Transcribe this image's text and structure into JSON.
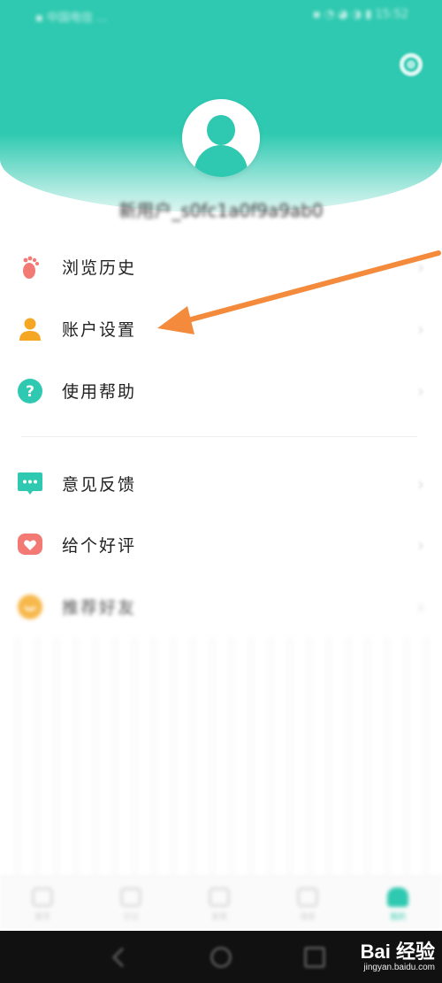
{
  "status_bar": {
    "left_text": "▪ 中国电信 ...",
    "right_text": "▪ ◔ ◕ ◑ ▮ 15:52"
  },
  "profile": {
    "username": "新用户_s0fc1a0f9a9ab0"
  },
  "menu": {
    "group1": [
      {
        "label": "浏览历史",
        "icon": "footprint-icon",
        "color": "#f37a74"
      },
      {
        "label": "账户设置",
        "icon": "user-icon",
        "color": "#f5a623"
      },
      {
        "label": "使用帮助",
        "icon": "help-icon",
        "color": "#2ec9b0"
      }
    ],
    "group2": [
      {
        "label": "意见反馈",
        "icon": "chat-icon",
        "color": "#2ec9b0"
      },
      {
        "label": "给个好评",
        "icon": "heart-icon",
        "color": "#f37a74"
      },
      {
        "label": "推荐好友",
        "icon": "smile-icon",
        "color": "#f7b84b"
      }
    ]
  },
  "bottom_nav": {
    "items": [
      {
        "label": "首页",
        "active": false
      },
      {
        "label": "日记",
        "active": false
      },
      {
        "label": "发现",
        "active": false
      },
      {
        "label": "消息",
        "active": false
      },
      {
        "label": "我的",
        "active": true
      }
    ]
  },
  "watermark": {
    "logo": "Bai 经验",
    "url": "jingyan.baidu.com"
  },
  "colors": {
    "brand": "#2ec9b0",
    "annotation_arrow": "#f38a3c"
  }
}
